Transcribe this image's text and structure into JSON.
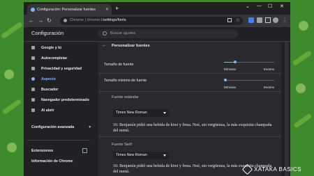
{
  "browser": {
    "tab_title": "Configuración: Personalizar fuentes",
    "new_tab": "+",
    "address_host": "Chrome | chrome://",
    "address_path": "settings/fonts",
    "window_controls": [
      "⌄",
      "—",
      "☐",
      "✕"
    ]
  },
  "settings": {
    "title": "Configuración",
    "search_placeholder": "Buscar ajustes",
    "sidebar": {
      "items": [
        {
          "label": "Google y tú",
          "icon": "person-icon"
        },
        {
          "label": "Autocompletar",
          "icon": "autofill-icon"
        },
        {
          "label": "Privacidad y seguridad",
          "icon": "shield-icon"
        },
        {
          "label": "Aspecto",
          "icon": "palette-icon",
          "active": true
        },
        {
          "label": "Buscador",
          "icon": "search-icon"
        },
        {
          "label": "Navegador predeterminado",
          "icon": "browser-icon"
        },
        {
          "label": "Al abrir",
          "icon": "power-icon"
        }
      ],
      "advanced": "Configuración avanzada",
      "extensions": "Extensiones",
      "about": "Información de Chrome"
    },
    "fonts": {
      "title": "Personalizar fuentes",
      "font_size": {
        "label": "Tamaño de fuente",
        "min": "Diminuto",
        "max": "Enorme",
        "value": 0.22
      },
      "min_font_size": {
        "label": "Tamaño mínimo de fuente",
        "min": "Diminuto",
        "max": "Enorme",
        "value": 0.0
      },
      "standard": {
        "title": "Fuente estándar",
        "value": "Times New Roman",
        "sample": "16: Benjamín pidió una bebida de kiwi y fresa. Noé, sin vergüenza, la más exquisita champaña del menú."
      },
      "serif": {
        "title": "Fuente Serif",
        "value": "Times New Roman",
        "sample": "16: Benjamín pidió una bebida de kiwi y fresa. Noé, sin vergüenza, la más exquisita champaña del menú."
      }
    }
  },
  "watermark": "XATAKA BASICS",
  "colors": {
    "background": "#3e8a2c",
    "accent": "#8ab4f8",
    "surface": "#292a2d"
  }
}
